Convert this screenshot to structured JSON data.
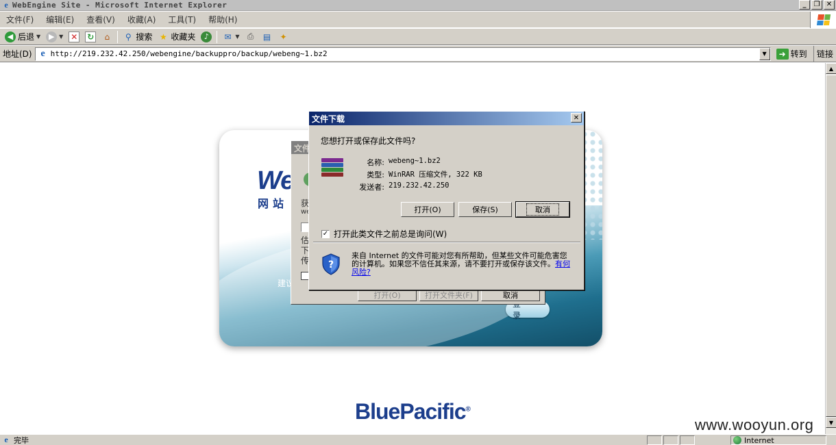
{
  "window": {
    "title": "WebEngine Site - Microsoft Internet Explorer",
    "controls": [
      "_",
      "❐",
      "✕"
    ]
  },
  "menu": [
    "文件(F)",
    "编辑(E)",
    "查看(V)",
    "收藏(A)",
    "工具(T)",
    "帮助(H)"
  ],
  "toolbar": {
    "back_label": "后退",
    "search_label": "搜索",
    "favorites_label": "收藏夹"
  },
  "address": {
    "label": "地址(D)",
    "url": "http://219.232.42.250/webengine/backuppro/backup/webeng~1.bz2",
    "go_label": "转到",
    "links_label": "链接"
  },
  "page": {
    "logo_text": "We",
    "logo_sub": "网站",
    "hint_text": "建议",
    "login_button": "登 录",
    "brand": "BluePacific",
    "brand_mark": "®"
  },
  "background_dialog": {
    "title": "文件",
    "line1": "获",
    "line2": "we",
    "line3": "估",
    "line4": "下",
    "line5": "传",
    "buttons": [
      "打开(O)",
      "打开文件夹(F)",
      "取消"
    ]
  },
  "dialog": {
    "title": "文件下载",
    "close": "✕",
    "question": "您想打开或保存此文件吗?",
    "name_label": "名称:",
    "name_value": "webeng~1.bz2",
    "type_label": "类型:",
    "type_value": "WinRAR 压缩文件, 322 KB",
    "from_label": "发送者:",
    "from_value": "219.232.42.250",
    "open_button": "打开(O)",
    "save_button": "保存(S)",
    "cancel_button": "取消",
    "checkbox_label": "打开此类文件之前总是询问(W)",
    "checkbox_checked": true,
    "warning_text": "来自 Internet 的文件可能对您有所帮助，但某些文件可能危害您的计算机。如果您不信任其来源，请不要打开或保存该文件。",
    "risk_link": "有何风险?"
  },
  "status": {
    "text": "完毕",
    "zone": "Internet"
  },
  "watermark": "www.wooyun.org"
}
